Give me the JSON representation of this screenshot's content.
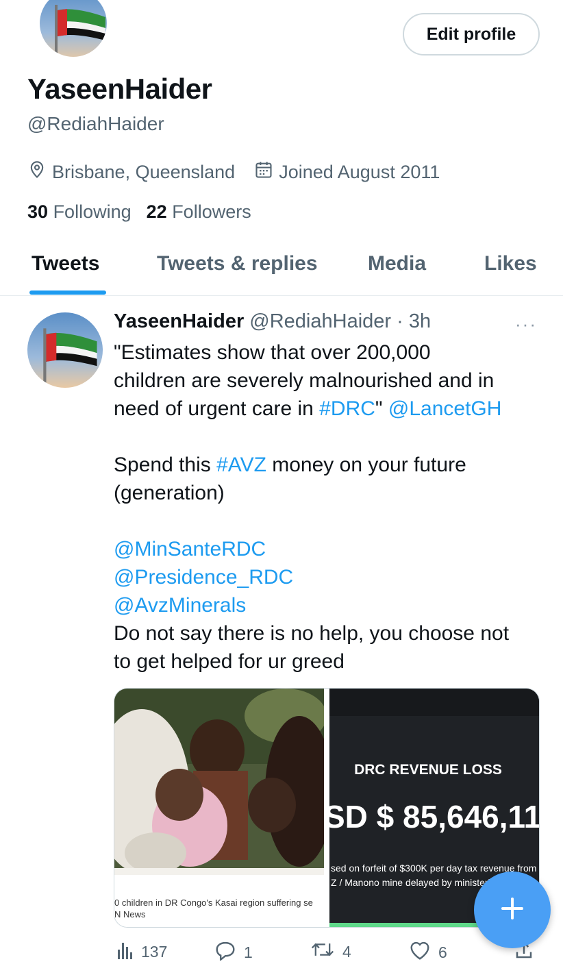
{
  "profile": {
    "edit_label": "Edit profile",
    "name": "YaseenHaider",
    "handle": "@RediahHaider",
    "location": "Brisbane, Queensland",
    "joined": "Joined August 2011",
    "following_count": "30",
    "following_label": "Following",
    "followers_count": "22",
    "followers_label": "Followers"
  },
  "tabs": [
    {
      "label": "Tweets"
    },
    {
      "label": "Tweets & replies"
    },
    {
      "label": "Media"
    },
    {
      "label": "Likes"
    }
  ],
  "tweet": {
    "name": "YaseenHaider",
    "handle_time": "@RediahHaider · 3h",
    "more": "···",
    "lines": {
      "l1": "\"Estimates show that over 200,000",
      "l2": "children are severely malnourished and in",
      "l3_a": "need of urgent care in ",
      "l3_tag": "#DRC",
      "l3_b": "\" ",
      "l3_mention": "@LancetGH",
      "l4_a": "Spend this ",
      "l4_tag": "#AVZ",
      "l4_b": " money on your future",
      "l5": "(generation)",
      "m1": "@MinSanteRDC",
      "m2": "@Presidence_RDC",
      "m3": "@AvzMinerals",
      "l6": "Do not say there is no help, you choose not",
      "l7": "to get helped for ur greed"
    },
    "media": {
      "left_caption_1": "0 children in DR Congo's Kasai region suffering se",
      "left_caption_2": "N News",
      "right_title": "DRC REVENUE LOSS",
      "right_amount": "SD $ 85,646,11",
      "right_sub_1": "sed on forfeit of $300K per day tax revenue from",
      "right_sub_2": "Z / Manono mine delayed by ministeri"
    },
    "actions": {
      "views": "137",
      "replies": "1",
      "retweets": "4",
      "likes": "6"
    }
  },
  "colors": {
    "accent": "#1d9bf0",
    "fab": "#4a9ff5",
    "secondary_text": "#536471"
  },
  "icons": [
    "location-icon",
    "calendar-icon",
    "more-icon",
    "views-icon",
    "reply-icon",
    "retweet-icon",
    "like-icon",
    "share-icon",
    "compose-plus-icon"
  ]
}
